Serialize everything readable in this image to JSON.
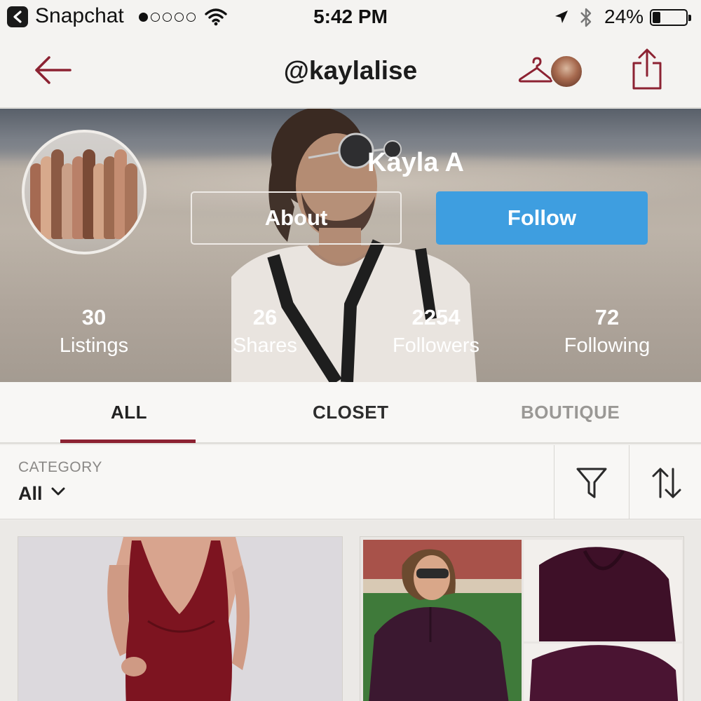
{
  "status_bar": {
    "app_name": "Snapchat",
    "time": "5:42 PM",
    "battery": "24%",
    "battery_level": 0.24,
    "signal_dots": 5,
    "signal_active": 1
  },
  "nav": {
    "title": "@kaylalise"
  },
  "profile": {
    "name": "Kayla A",
    "about_label": "About",
    "follow_label": "Follow",
    "stats": [
      {
        "value": "30",
        "label": "Listings"
      },
      {
        "value": "26",
        "label": "Shares"
      },
      {
        "value": "2254",
        "label": "Followers"
      },
      {
        "value": "72",
        "label": "Following"
      }
    ]
  },
  "tabs": [
    {
      "label": "ALL",
      "active": true
    },
    {
      "label": "CLOSET",
      "active": false
    },
    {
      "label": "BOUTIQUE",
      "active": false
    }
  ],
  "filter": {
    "category_label": "CATEGORY",
    "category_value": "All"
  },
  "colors": {
    "accent": "#8c2232",
    "follow": "#3e9ee0"
  }
}
